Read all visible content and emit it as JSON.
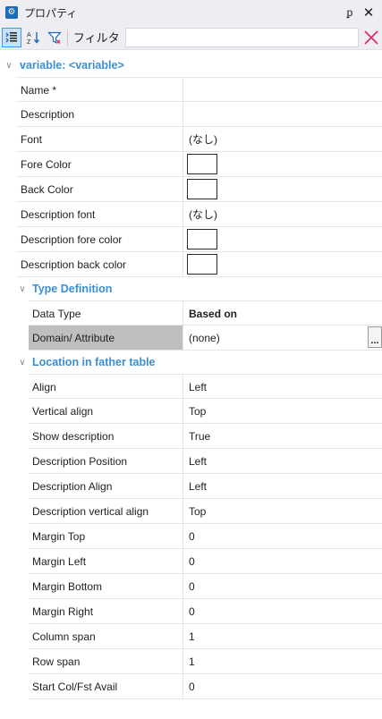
{
  "window": {
    "title": "プロパティ",
    "pin_glyph": "ᵱ",
    "close_glyph": "✕"
  },
  "toolbar": {
    "categorized_icon": "categorized-view-icon",
    "alphabetical_icon": "sort-alphabetical-icon",
    "filter_icon": "funnel-filter-icon",
    "filter_label": "フィルタ",
    "filter_value": "",
    "filter_placeholder": "",
    "clear_glyph": "✕"
  },
  "colors": {
    "category_text": "#3a8fd0",
    "selected_name_bg": "#bebebe",
    "clear_x": "#e0245e",
    "active_button": "#3399ff"
  },
  "grid": {
    "root": {
      "label": "variable: <variable>",
      "properties": [
        {
          "name": "Name *",
          "value": ""
        },
        {
          "name": "Description",
          "value": ""
        },
        {
          "name": "Font",
          "value": "(なし)"
        },
        {
          "name": "Fore Color",
          "value": "",
          "swatch": "#ffffff"
        },
        {
          "name": "Back Color",
          "value": "",
          "swatch": "#ffffff"
        },
        {
          "name": "Description font",
          "value": "(なし)"
        },
        {
          "name": "Description fore color",
          "value": "",
          "swatch": "#ffffff"
        },
        {
          "name": "Description back color",
          "value": "",
          "swatch": "#ffffff"
        }
      ]
    },
    "type_definition": {
      "label": "Type Definition",
      "properties": [
        {
          "name": "Data Type",
          "value": "Based on"
        },
        {
          "name": "Domain/ Attribute",
          "value": "(none)",
          "button": "..."
        }
      ]
    },
    "location": {
      "label": "Location in father table",
      "properties": [
        {
          "name": "Align",
          "value": "Left"
        },
        {
          "name": "Vertical align",
          "value": "Top"
        },
        {
          "name": "Show description",
          "value": "True"
        },
        {
          "name": "Description Position",
          "value": "Left"
        },
        {
          "name": "Description Align",
          "value": "Left"
        },
        {
          "name": "Description vertical align",
          "value": "Top"
        },
        {
          "name": "Margin Top",
          "value": "0"
        },
        {
          "name": "Margin Left",
          "value": "0"
        },
        {
          "name": "Margin Bottom",
          "value": "0"
        },
        {
          "name": "Margin Right",
          "value": "0"
        },
        {
          "name": "Column span",
          "value": "1"
        },
        {
          "name": "Row span",
          "value": "1"
        },
        {
          "name": "Start Col/Fst Avail",
          "value": "0"
        }
      ]
    }
  }
}
